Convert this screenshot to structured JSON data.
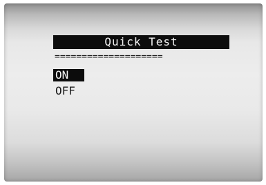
{
  "screen": {
    "title": "Quick Test",
    "divider": "====================",
    "menu": {
      "items": [
        {
          "label": "ON",
          "selected": true
        },
        {
          "label": "OFF",
          "selected": false
        }
      ]
    }
  },
  "colors": {
    "highlight_bg": "#0c0c0c",
    "highlight_text": "#f4f4f4",
    "text": "#1a1a1a",
    "screen_bg": "#e8e8e8"
  }
}
